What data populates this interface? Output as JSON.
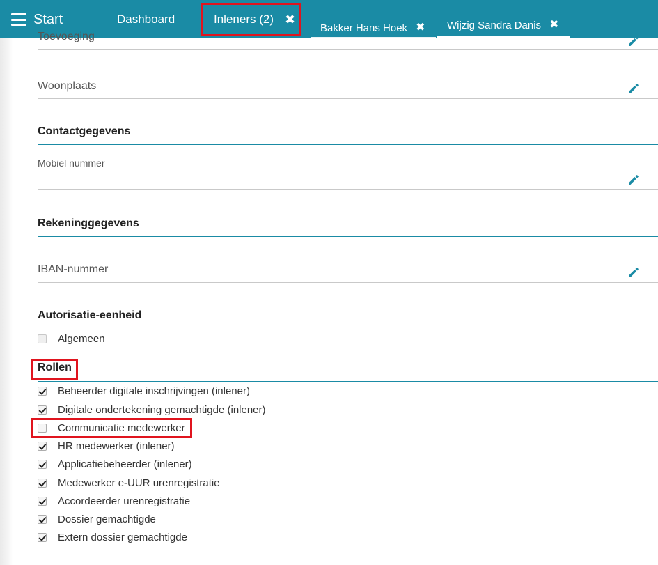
{
  "topbar": {
    "menu_label": "Start",
    "tabs": [
      {
        "label": "Dashboard"
      },
      {
        "label": "Inleners (2)",
        "close": "✖"
      },
      {
        "label": "Bakker Hans Hoek",
        "close": "✖"
      },
      {
        "label": "Wijzig Sandra Danis",
        "close": "✖"
      }
    ]
  },
  "fields": {
    "toevoeging": "Toevoeging",
    "woonplaats": "Woonplaats",
    "mobiel": "Mobiel nummer",
    "iban": "IBAN-nummer"
  },
  "sections": {
    "contact": "Contactgegevens",
    "rekening": "Rekeninggegevens",
    "autorisatie": "Autorisatie-eenheid",
    "rollen": "Rollen"
  },
  "autorisatie_items": [
    {
      "label": "Algemeen",
      "checked": false
    }
  ],
  "rollen_items": [
    {
      "label": "Beheerder digitale inschrijvingen (inlener)",
      "checked": true
    },
    {
      "label": "Digitale ondertekening gemachtigde (inlener)",
      "checked": true
    },
    {
      "label": "Communicatie medewerker",
      "checked": false
    },
    {
      "label": "HR medewerker (inlener)",
      "checked": true
    },
    {
      "label": "Applicatiebeheerder (inlener)",
      "checked": true
    },
    {
      "label": "Medewerker e-UUR urenregistratie",
      "checked": true
    },
    {
      "label": "Accordeerder urenregistratie",
      "checked": true
    },
    {
      "label": "Dossier gemachtigde",
      "checked": true
    },
    {
      "label": "Extern dossier gemachtigde",
      "checked": true
    }
  ],
  "icons": {
    "menu": "hamburger-icon",
    "close": "close-icon",
    "edit": "pencil-icon"
  },
  "colors": {
    "brand": "#1a8ba5",
    "highlight": "#e0141e"
  }
}
